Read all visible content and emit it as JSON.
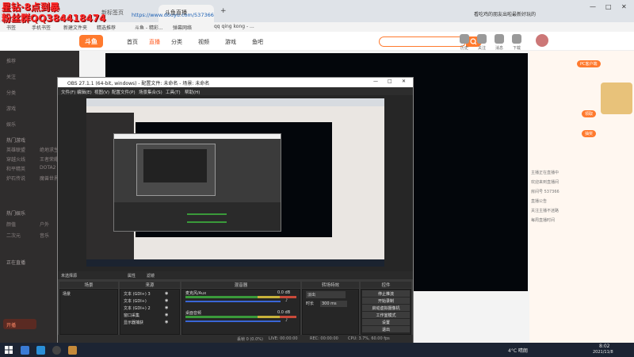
{
  "watermark": {
    "line1": "星钻·8点到暴",
    "line2": "粉丝群QQ384418474"
  },
  "browser": {
    "tabs": [
      "新标签页",
      "斗鱼直播",
      "douyu.com/537366"
    ],
    "url": "https://www.douyu.com/537366",
    "side_text": "看吃鸡的朋友出啦最新好玩的",
    "bookmarks": [
      "书签",
      "手机书签",
      "新建文件夹",
      "精选推荐",
      "斗鱼 - 精彩...",
      "弹幕网络",
      "qq qing kong - ..."
    ]
  },
  "site": {
    "logo": "斗鱼",
    "nav": [
      "首页",
      "直播",
      "分类",
      "视频",
      "游戏",
      "鱼吧"
    ],
    "nav_active_index": 1,
    "header_icons": [
      "历史",
      "关注",
      "消息",
      "下载"
    ]
  },
  "sidebar": {
    "items": [
      "推荐",
      "关注",
      "分类",
      "游戏",
      "娱乐"
    ],
    "section1": "热门游戏",
    "games": [
      "英雄联盟",
      "绝地求生",
      "穿越火线",
      "王者荣耀",
      "和平精英",
      "DOTA2",
      "炉石传说",
      "魔兽世界"
    ],
    "section2": "热门娱乐",
    "ent": [
      "颜值",
      "户外",
      "二次元",
      "音乐"
    ],
    "section3": "正在直播",
    "button": "开播"
  },
  "right_panel": {
    "badge": "PC客户端",
    "pills": [
      "领取",
      "抽奖"
    ],
    "lines": [
      "主播正在直播中",
      "欢迎来到直播间",
      "房间号 537366",
      "直播公告",
      "关注主播不迷路",
      "每周直播时间"
    ]
  },
  "obs": {
    "title": "OBS 27.1.1 (64-bit, windows) - 配置文件: 未命名 - 场景: 未命名",
    "menu": [
      "文件(F)",
      "编辑(E)",
      "视图(V)",
      "配置文件(P)",
      "场景集合(S)",
      "工具(T)",
      "帮助(H)"
    ],
    "bar_left": "未选择源",
    "bar_props": "属性",
    "bar_filters": "滤镜",
    "docks": [
      "场景",
      "来源",
      "混音器",
      "转场特效",
      "控件"
    ],
    "scene": "场景",
    "sources": [
      "文本 (GDI+) 3",
      "文本 (GDI+)",
      "文本 (GDI+) 2",
      "窗口采集",
      "显示器捕获"
    ],
    "mixer": [
      {
        "name": "麦克风/Aux",
        "db": "0.0 dB"
      },
      {
        "name": "桌面音频",
        "db": "0.0 dB"
      }
    ],
    "transition": "淡出",
    "duration_label": "时长",
    "duration": "300 ms",
    "controls": [
      "停止推流",
      "开始录制",
      "启动虚拟摄像机",
      "工作室模式",
      "设置",
      "退出"
    ],
    "status": {
      "drop": "丢帧 0 (0.0%)",
      "live": "LIVE: 00:00:00",
      "rec": "REC: 00:00:00",
      "cpu": "CPU: 3.7%, 60.00 fps"
    }
  },
  "taskbar": {
    "weather": "4°C 晴朗",
    "time": "8:02",
    "date": "2021/11/8"
  }
}
